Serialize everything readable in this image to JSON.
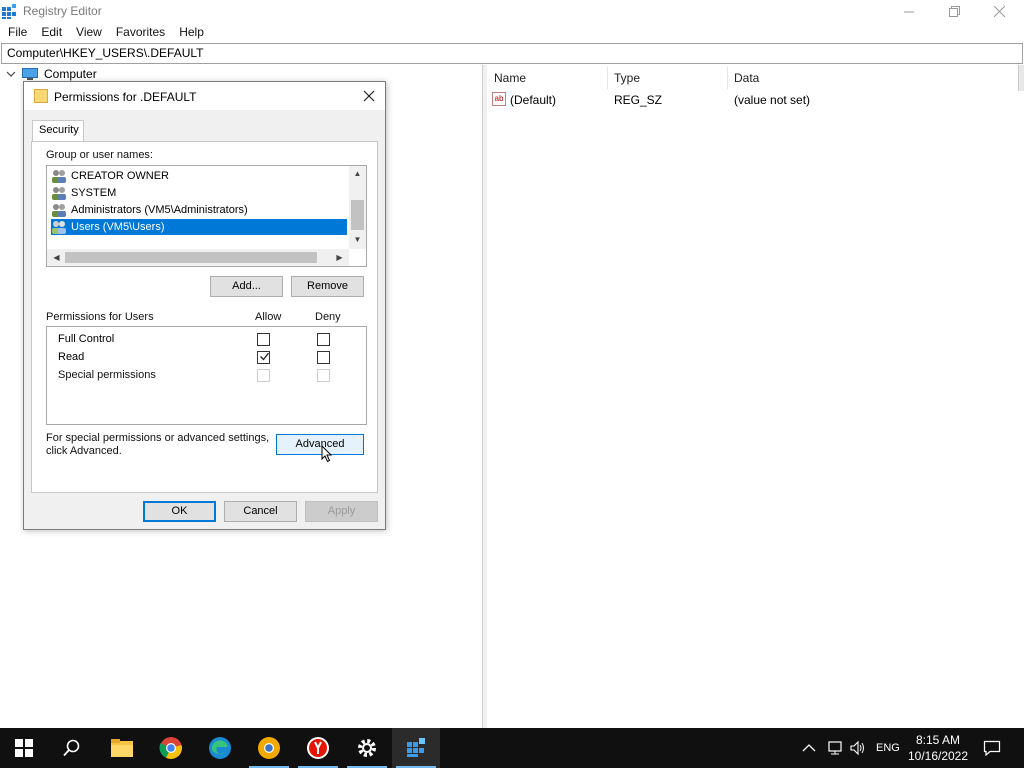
{
  "window": {
    "title": "Registry Editor"
  },
  "menu": [
    "File",
    "Edit",
    "View",
    "Favorites",
    "Help"
  ],
  "address": "Computer\\HKEY_USERS\\.DEFAULT",
  "tree": {
    "root_label": "Computer"
  },
  "list": {
    "columns": [
      "Name",
      "Type",
      "Data"
    ],
    "rows": [
      {
        "name": "(Default)",
        "type": "REG_SZ",
        "data": "(value not set)"
      }
    ]
  },
  "dialog": {
    "title": "Permissions for .DEFAULT",
    "tab": "Security",
    "group_label": "Group or user names:",
    "users": [
      "CREATOR OWNER",
      "SYSTEM",
      "Administrators (VM5\\Administrators)",
      "Users (VM5\\Users)"
    ],
    "selected_user_index": 3,
    "add_label": "Add...",
    "remove_label": "Remove",
    "permissions_for": "Permissions for Users",
    "allow_label": "Allow",
    "deny_label": "Deny",
    "permissions": [
      {
        "name": "Full Control",
        "allow": false,
        "deny": false,
        "enabled": true
      },
      {
        "name": "Read",
        "allow": true,
        "deny": false,
        "enabled": true
      },
      {
        "name": "Special permissions",
        "allow": false,
        "deny": false,
        "enabled": false
      }
    ],
    "hint": "For special permissions or advanced settings, click Advanced.",
    "advanced_label": "Advanced",
    "ok_label": "OK",
    "cancel_label": "Cancel",
    "apply_label": "Apply"
  },
  "taskbar": {
    "apps": [
      "start-icon",
      "search-icon",
      "file-explorer-icon",
      "chrome-icon",
      "edge-icon",
      "chrome-canary-icon",
      "yandex-icon",
      "settings-icon",
      "regedit-icon"
    ],
    "language": "ENG",
    "time": "8:15 AM",
    "date": "10/16/2022"
  },
  "colors": {
    "selection": "#0078d7",
    "taskbar": "#101010",
    "accent_underline": "#76b9ed"
  }
}
